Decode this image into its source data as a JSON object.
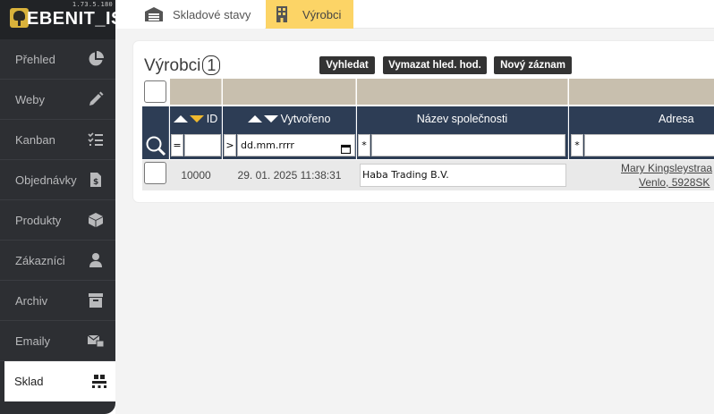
{
  "app": {
    "version": "1.73.5.180",
    "logo_text": "EBENIT_IS"
  },
  "sidebar": {
    "items": [
      {
        "label": "Přehled",
        "icon": "pie-chart-icon"
      },
      {
        "label": "Weby",
        "icon": "pencil-icon"
      },
      {
        "label": "Kanban",
        "icon": "checklist-icon"
      },
      {
        "label": "Objednávky",
        "icon": "invoice-icon"
      },
      {
        "label": "Produkty",
        "icon": "box-icon"
      },
      {
        "label": "Zákazníci",
        "icon": "user-icon"
      },
      {
        "label": "Archiv",
        "icon": "archive-icon"
      },
      {
        "label": "Emaily",
        "icon": "email-icon"
      },
      {
        "label": "Sklad",
        "icon": "pallet-icon",
        "active": true
      }
    ]
  },
  "tabs": [
    {
      "label": "Skladové stavy",
      "icon": "warehouse-icon"
    },
    {
      "label": "Výrobci",
      "icon": "building-icon",
      "active": true
    }
  ],
  "main": {
    "title": "Výrobci",
    "count": "1",
    "buttons": {
      "search": "Vyhledat",
      "clear": "Vymazat hled. hod.",
      "new": "Nový záznam"
    },
    "table": {
      "columns": {
        "id": "ID",
        "created": "Vytvořeno",
        "company": "Název společnosti",
        "address": "Adresa"
      },
      "filters": {
        "id_op": "=",
        "id_value": "",
        "created_op": ">",
        "created_placeholder": "dd.mm.rrrr",
        "company_op": "*",
        "company_value": "",
        "address_op": "*",
        "address_value": ""
      },
      "rows": [
        {
          "id": "10000",
          "created": "29. 01. 2025 11:38:31",
          "company": "Haba Trading B.V.",
          "address_line1": "Mary Kingsleystraa",
          "address_line2": "Venlo, 5928SK"
        }
      ]
    }
  },
  "colors": {
    "sidebar_bg": "#2d2f33",
    "accent": "#fcd466",
    "header_bg": "#2d3d55",
    "group_header_bg": "#c8bfae",
    "sort_accent": "#f0b92e"
  }
}
